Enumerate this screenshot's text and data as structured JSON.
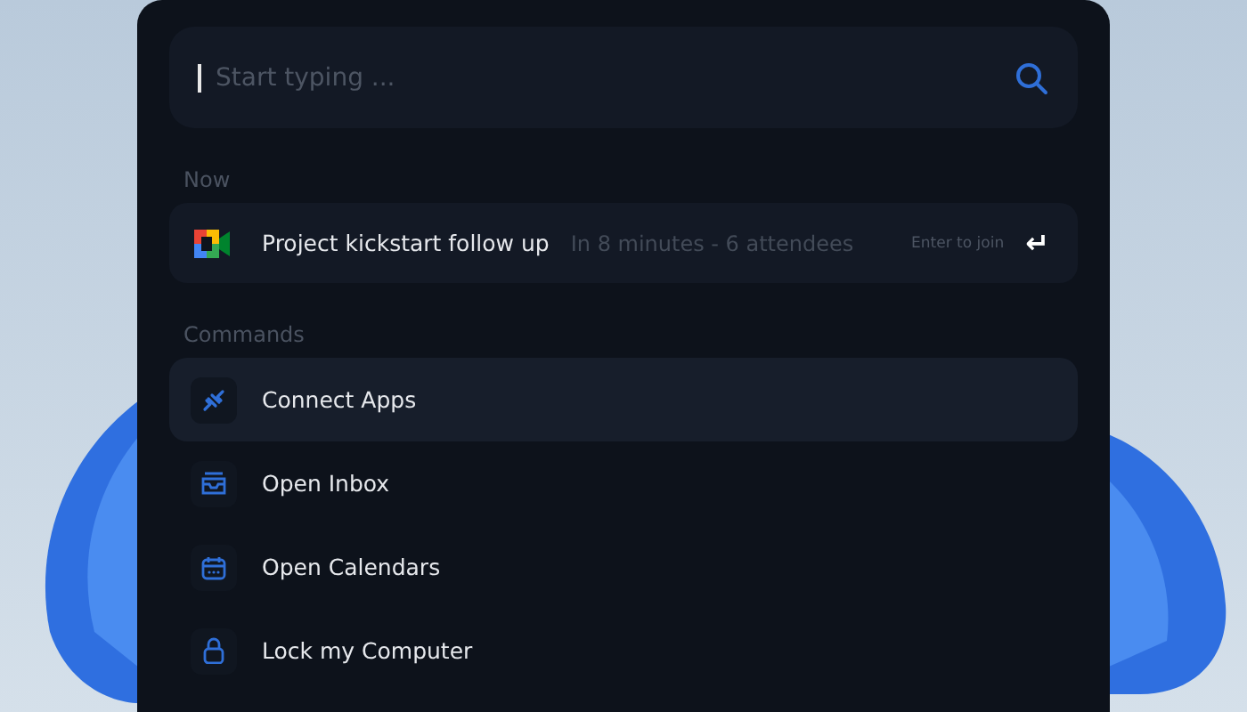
{
  "search": {
    "placeholder": "Start typing ..."
  },
  "now_section": {
    "heading": "Now",
    "event": {
      "title": "Project kickstart follow up",
      "detail": "In 8 minutes - 6 attendees",
      "hint": "Enter to join",
      "key": "↵"
    }
  },
  "commands_section": {
    "heading": "Commands",
    "items": [
      {
        "label": "Connect Apps",
        "kind": "plug",
        "selected": true
      },
      {
        "label": "Open Inbox",
        "kind": "inbox",
        "selected": false
      },
      {
        "label": "Open Calendars",
        "kind": "calendar",
        "selected": false
      },
      {
        "label": "Lock my Computer",
        "kind": "lock",
        "selected": false
      }
    ]
  }
}
